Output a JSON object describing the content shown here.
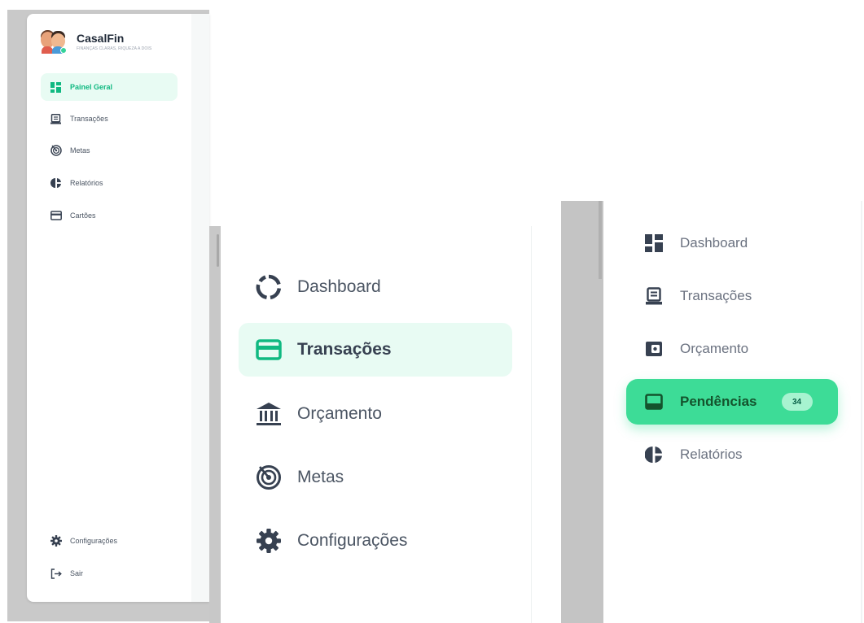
{
  "panel_a": {
    "brand": {
      "name": "CasalFin",
      "tagline": "FINANÇAS CLARAS, RIQUEZA A DOIS"
    },
    "nav": [
      {
        "label": "Painel Geral",
        "icon": "grid-icon",
        "active": true
      },
      {
        "label": "Transações",
        "icon": "receipt-icon",
        "active": false
      },
      {
        "label": "Metas",
        "icon": "target-icon",
        "active": false
      },
      {
        "label": "Relatórios",
        "icon": "pie-chart-icon",
        "active": false
      },
      {
        "label": "Cartões",
        "icon": "credit-card-icon",
        "active": false
      }
    ],
    "footer": [
      {
        "label": "Configurações",
        "icon": "gear-icon"
      },
      {
        "label": "Sair",
        "icon": "logout-icon"
      }
    ]
  },
  "panel_b": {
    "nav": [
      {
        "label": "Dashboard",
        "icon": "ring-chart-icon",
        "active": false
      },
      {
        "label": "Transações",
        "icon": "credit-card-icon",
        "active": true
      },
      {
        "label": "Orçamento",
        "icon": "bank-icon",
        "active": false
      },
      {
        "label": "Metas",
        "icon": "target-icon",
        "active": false
      },
      {
        "label": "Configurações",
        "icon": "gear-icon",
        "active": false
      }
    ]
  },
  "panel_c": {
    "nav": [
      {
        "label": "Dashboard",
        "icon": "grid-icon",
        "active": false
      },
      {
        "label": "Transações",
        "icon": "receipt-icon",
        "active": false
      },
      {
        "label": "Orçamento",
        "icon": "wallet-icon",
        "active": false
      },
      {
        "label": "Pendências",
        "icon": "inbox-icon",
        "active": true,
        "badge": "34"
      },
      {
        "label": "Relatórios",
        "icon": "pie-chart-icon",
        "active": false
      }
    ]
  },
  "colors": {
    "accent": "#10b981",
    "accent_soft": "#e8fbf3",
    "accent_strong": "#3ddc97",
    "text": "#4b5563"
  }
}
